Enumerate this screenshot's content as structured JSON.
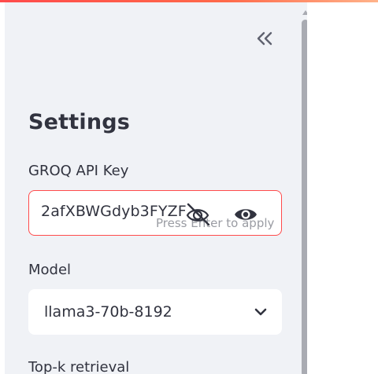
{
  "sidebar": {
    "title": "Settings",
    "collapse_icon": "double-chevron-left-icon",
    "api_key": {
      "label": "GROQ API Key",
      "visible_value": "2afXBWGdyb3FYZF",
      "hint": "Press Enter to apply",
      "icons": [
        "eye-off-icon",
        "eye-icon"
      ]
    },
    "model": {
      "label": "Model",
      "selected": "llama3-70b-8192"
    },
    "topk": {
      "label": "Top-k retrieval"
    }
  },
  "colors": {
    "accent": "#ff4b4b",
    "sidebar_bg": "#f0f2f6",
    "text": "#31333f",
    "hint": "#9a9ca3",
    "scrollbar": "#a9abb2"
  }
}
